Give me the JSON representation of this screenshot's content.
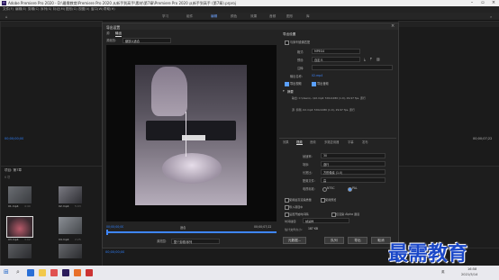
{
  "window": {
    "title": "Adobe Premiere Pro 2020 - D:\\最需教育\\Premiere Pro 2020 从新手到高手\\素材\\第7章\\Premiere Pro 2020 从新手到高手 (第7章).prproj"
  },
  "menubar": {
    "items": [
      "文件(F)",
      "编辑(E)",
      "剪辑(C)",
      "序列(S)",
      "标记(M)",
      "图形(G)",
      "视图(V)",
      "窗口(W)",
      "帮助(H)"
    ]
  },
  "workspaces": {
    "items": [
      "学习",
      "组件",
      "编辑",
      "颜色",
      "效果",
      "音频",
      "图形",
      "库"
    ],
    "active_index": 2
  },
  "left_panel": {
    "timecode": "00;00;00;00",
    "project_title": "项目: 第7章",
    "project_count": "6 项",
    "clips": [
      {
        "name": "01.mp4",
        "duration": "4:40"
      },
      {
        "name": "02.mp4",
        "duration": "5:03"
      },
      {
        "name": "03.mp4",
        "duration": "3:02"
      },
      {
        "name": "04.mp4",
        "duration": "2:25"
      },
      {
        "name": "05.mp4",
        "duration": "5:01"
      },
      {
        "name": "06.mp4",
        "duration": "4:26"
      }
    ]
  },
  "right_panel": {
    "timecode": "00;00;07;22"
  },
  "dialog": {
    "title": "导出设置",
    "left_tabs": [
      "源",
      "输出"
    ],
    "source_scaling_label": "源缩放:",
    "source_scaling_value": "缩放以适合",
    "timecode_in": "00;00;00;00",
    "timecode_out": "00;00;07;22",
    "fit_label": "适合",
    "range_label": "源范围:",
    "range_value": "整个剪辑/序列",
    "export_settings": {
      "header": "导出设置",
      "match_sequence": "与序列设置匹配",
      "format_label": "格式:",
      "format_value": "MPEG4",
      "preset_label": "预设:",
      "preset_value": "自定义",
      "comment_label": "注释:",
      "output_name_label": "输出名称:",
      "output_name_value": "02.mp4",
      "export_video": "导出视频",
      "export_audio": "导出音频",
      "summary_header": "摘要",
      "summary_output": "输出: C:\\Users\\...\\02.mp4  720x1280 (1.0), 29.97 fps, 逐行",
      "summary_source": "源: 剪辑, 02.mp4  720x1280 (1.0), 29.97 fps, 逐行"
    },
    "tabs": [
      "效果",
      "视频",
      "音频",
      "多路复用器",
      "字幕",
      "发布"
    ],
    "active_tab": 1,
    "video_section": {
      "header": "视频",
      "frame_rate_label": "帧速率:",
      "frame_rate_value": "30",
      "field_order_label": "场序:",
      "field_order_value": "逐行",
      "aspect_label": "长宽比:",
      "aspect_value": "方形像素 (1.0)",
      "profile_label": "配置文件:",
      "profile_value": "高",
      "tv_standard_label": "电视标准:",
      "ntsc": "NTSC",
      "pal": "PAL"
    },
    "options": [
      "使用最高渲染质量",
      "使用预览",
      "导入项目中",
      "设置开始时间码",
      "仅渲染 Alpha 通道"
    ],
    "interpolation_label": "时间插值:",
    "interpolation_value": "帧采样",
    "filesize_label": "估计文件大小:",
    "filesize_value": "187 KB",
    "buttons": {
      "metadata": "元数据...",
      "queue": "队列",
      "export": "导出",
      "cancel": "取消"
    }
  },
  "bottom_timeline": {
    "timecode": "00;00;00;00"
  },
  "taskbar": {
    "time": "16:58",
    "date": "2021/5/14",
    "lang": "英"
  },
  "watermark": "最需教育"
}
